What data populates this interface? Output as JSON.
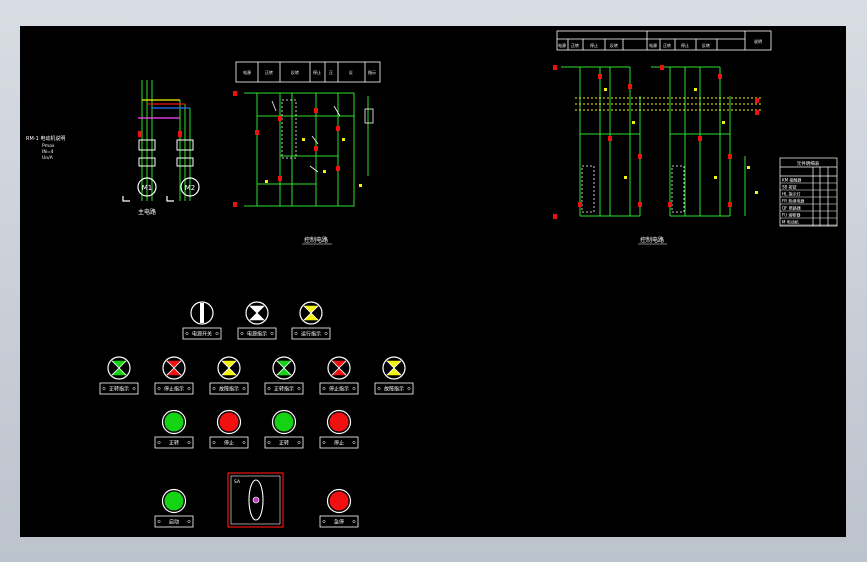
{
  "drawing": {
    "motor_note": [
      "RM-1 电动机说明",
      "Pmax",
      "IN=4",
      "Un/A"
    ],
    "motor_label": "主电路",
    "motor_names": [
      "M1",
      "M2"
    ],
    "circuit1_caption": "控制电路",
    "circuit2_caption": "控制电路",
    "circuit1_header": [
      "电源",
      "正转",
      "反转",
      "停止",
      "正",
      "反",
      "指示"
    ],
    "circuit2_header": [
      "电源",
      "正转",
      "停止",
      "反转",
      "电源",
      "正转",
      "停止",
      "反转",
      "说明"
    ],
    "table_title": "元件明细表",
    "table_rows": [
      "KM 接触器",
      "SB 按钮",
      "HL 指示灯",
      "FR 热继电器",
      "QF 断路器",
      "FU 熔断器",
      "M 电动机"
    ]
  },
  "panel": {
    "labels": [
      "电源开关",
      "电源指示",
      "运行指示",
      "正转指示",
      "停止指示",
      "故障指示",
      "正转指示",
      "停止指示",
      "故障指示",
      "正转",
      "停止",
      "正转",
      "停止",
      "启动",
      "急停"
    ],
    "switch_label": "SA"
  },
  "colors": {
    "green": "#13d313",
    "red": "#f01010",
    "yellow": "#f2f20e",
    "white": "#ffffff",
    "wire": "#2ee02e",
    "bg": "#000000"
  }
}
